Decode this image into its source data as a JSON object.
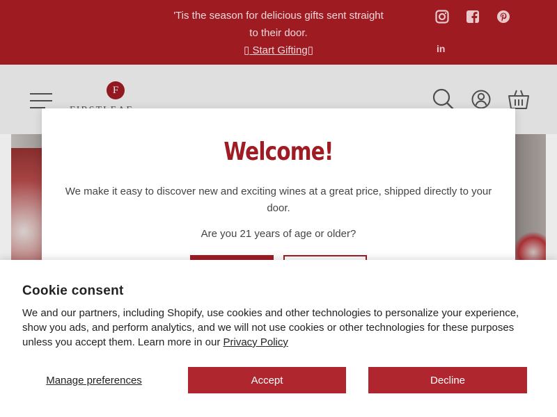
{
  "announcement": {
    "line1": "'Tis the season for delicious gifts sent straight",
    "line2": "to their door.",
    "link_label": " Start Gifting",
    "link_prefix_glyph": "▯",
    "link_suffix_glyph": "▯"
  },
  "social": {
    "icons": [
      "instagram-icon",
      "facebook-icon",
      "pinterest-icon",
      "linkedin-icon"
    ],
    "linkedin_text": "in"
  },
  "header": {
    "logo_mark": "F",
    "logo_text": "FIRSTLEAF"
  },
  "age_gate": {
    "title": "Welcome!",
    "body": "We make it easy to discover new and exciting wines at a great price, shipped directly to your door.",
    "question": "Are you 21 years of age or older?"
  },
  "cookie": {
    "title": "Cookie consent",
    "text": "We and our partners, including Shopify, use cookies and other technologies to personalize your experience, show you ads, and perform analytics, and we will not use cookies or other technologies for these purposes unless you accept them. Learn more in our ",
    "privacy_link": "Privacy Policy",
    "manage_label": "Manage preferences",
    "accept_label": "Accept",
    "decline_label": "Decline"
  },
  "colors": {
    "brand": "#a01c24",
    "announcement_bg": "#9e1b22",
    "button_bg": "#b0262e"
  }
}
